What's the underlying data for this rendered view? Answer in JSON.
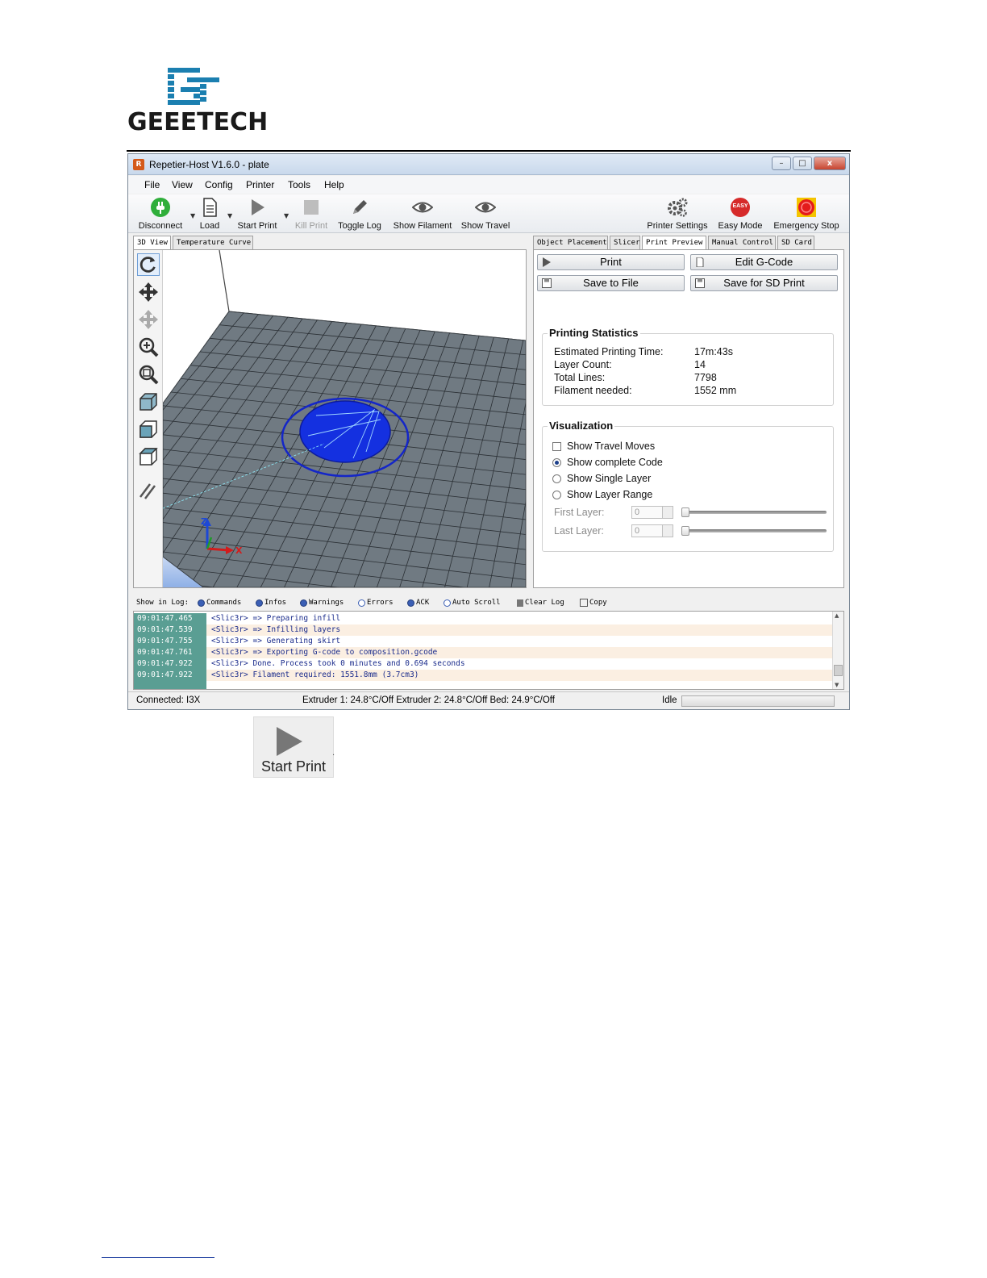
{
  "logo": {
    "text": "GEEETECH",
    "brand_color": "#1b7fb0"
  },
  "window": {
    "title": "Repetier-Host V1.6.0 - plate",
    "controls": {
      "minimize": "–",
      "maximize": "□",
      "close": "x"
    }
  },
  "menu": [
    "File",
    "View",
    "Config",
    "Printer",
    "Tools",
    "Help"
  ],
  "toolbar": {
    "disconnect": "Disconnect",
    "load": "Load",
    "start_print": "Start Print",
    "kill_print": "Kill Print",
    "toggle_log": "Toggle Log",
    "show_filament": "Show Filament",
    "show_travel": "Show Travel",
    "printer_settings": "Printer Settings",
    "easy_mode": "Easy Mode",
    "easy_badge": "EASY",
    "emergency_stop": "Emergency Stop"
  },
  "left_tabs": [
    "3D View",
    "Temperature Curve"
  ],
  "axes": {
    "z": "Z",
    "x": "X"
  },
  "right_tabs": [
    "Object Placement",
    "Slicer",
    "Print Preview",
    "Manual Control",
    "SD Card"
  ],
  "preview": {
    "print_btn": "Print",
    "edit_gcode_btn": "Edit G-Code",
    "save_file_btn": "Save to File",
    "save_sd_btn": "Save for SD Print",
    "stats_title": "Printing Statistics",
    "stats": [
      {
        "k": "Estimated Printing Time:",
        "v": "17m:43s"
      },
      {
        "k": "Layer Count:",
        "v": "14"
      },
      {
        "k": "Total Lines:",
        "v": "7798"
      },
      {
        "k": "Filament needed:",
        "v": "1552 mm"
      }
    ],
    "vis_title": "Visualization",
    "show_travel_moves": "Show Travel Moves",
    "show_complete_code": "Show complete Code",
    "show_single_layer": "Show Single Layer",
    "show_layer_range": "Show Layer Range",
    "first_layer_label": "First Layer:",
    "last_layer_label": "Last Layer:",
    "first_layer_value": "0",
    "last_layer_value": "0"
  },
  "log_options": {
    "show_in_log": "Show in Log:",
    "commands": "Commands",
    "infos": "Infos",
    "warnings": "Warnings",
    "errors": "Errors",
    "ack": "ACK",
    "auto_scroll": "Auto Scroll",
    "clear_log": "Clear Log",
    "copy": "Copy"
  },
  "log": [
    {
      "time": "09:01:47.465",
      "msg": "<Slic3r> => Preparing infill"
    },
    {
      "time": "09:01:47.539",
      "msg": "<Slic3r> => Infilling layers"
    },
    {
      "time": "09:01:47.755",
      "msg": "<Slic3r> => Generating skirt"
    },
    {
      "time": "09:01:47.761",
      "msg": "<Slic3r> => Exporting G-code to composition.gcode"
    },
    {
      "time": "09:01:47.922",
      "msg": "<Slic3r> Done. Process took 0 minutes and 0.694 seconds"
    },
    {
      "time": "09:01:47.922",
      "msg": "<Slic3r> Filament required: 1551.8mm (3.7cm3)"
    }
  ],
  "status": {
    "connected": "Connected: I3X",
    "temps": "Extruder 1: 24.8°C/Off Extruder 2: 24.8°C/Off Bed: 24.9°C/Off",
    "state": "Idle"
  },
  "zoom": {
    "start_print": "Start Print"
  }
}
